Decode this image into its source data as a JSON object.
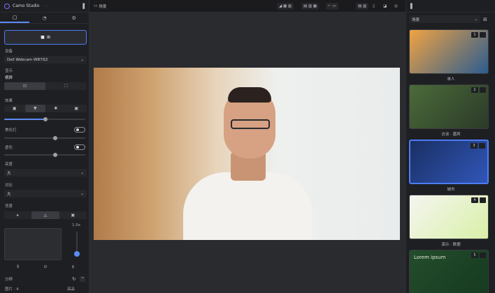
{
  "app": {
    "title": "Camo Studio",
    "version": "· · ·"
  },
  "left_tabs": [
    {
      "icon": "camera-icon"
    },
    {
      "icon": "mask-icon"
    },
    {
      "icon": "gear-icon"
    }
  ],
  "camera_button": {
    "label": "⊞"
  },
  "device": {
    "label": "设备",
    "value": "Dell Webcam WB7ᗡ2",
    "arrow": "⌄"
  },
  "format": {
    "label": "显示",
    "value": "横屏"
  },
  "orientation": {
    "label": "方向"
  },
  "effects": {
    "label": "效果"
  },
  "rows": [
    {
      "label": "美化灯",
      "toggle": false
    },
    {
      "label": "虚化",
      "toggle": true
    },
    {
      "label": "亮度",
      "value": "大"
    },
    {
      "label": "对比",
      "value": "大"
    }
  ],
  "background": {
    "label": "背景"
  },
  "zoom": {
    "readout": "1.0x"
  },
  "footer": {
    "label": "分辨",
    "value": "高品",
    "label2": "图片 · 4"
  },
  "topbar": {
    "scene_label": "场景",
    "items": [
      "◢ ▦ ▥",
      "▤ ▥ ▦",
      "⌐ ▭",
      "▤ ▥"
    ]
  },
  "right_panel": {
    "title": "场景"
  },
  "scenes": [
    {
      "caption": "单人",
      "badge": "1",
      "colors": [
        "#f0a343",
        "#2b5c8f"
      ],
      "selected": false
    },
    {
      "caption": "访谈 · 嘉宾",
      "badge": "2",
      "colors": [
        "#4b6b3a",
        "#2b3a28"
      ],
      "selected": false
    },
    {
      "caption": "城市",
      "badge": "3",
      "colors": [
        "#1a2f63",
        "#3056b8"
      ],
      "selected": true
    },
    {
      "caption": "演示 · 数据",
      "badge": "4",
      "colors": [
        "#f5f5f0",
        "#d9f0a8"
      ],
      "selected": false
    },
    {
      "caption": "Lorem ipsum",
      "badge": "5",
      "colors": [
        "#234d2c",
        "#163a1f"
      ],
      "selected": false
    }
  ],
  "accent": "#4d7cf5"
}
